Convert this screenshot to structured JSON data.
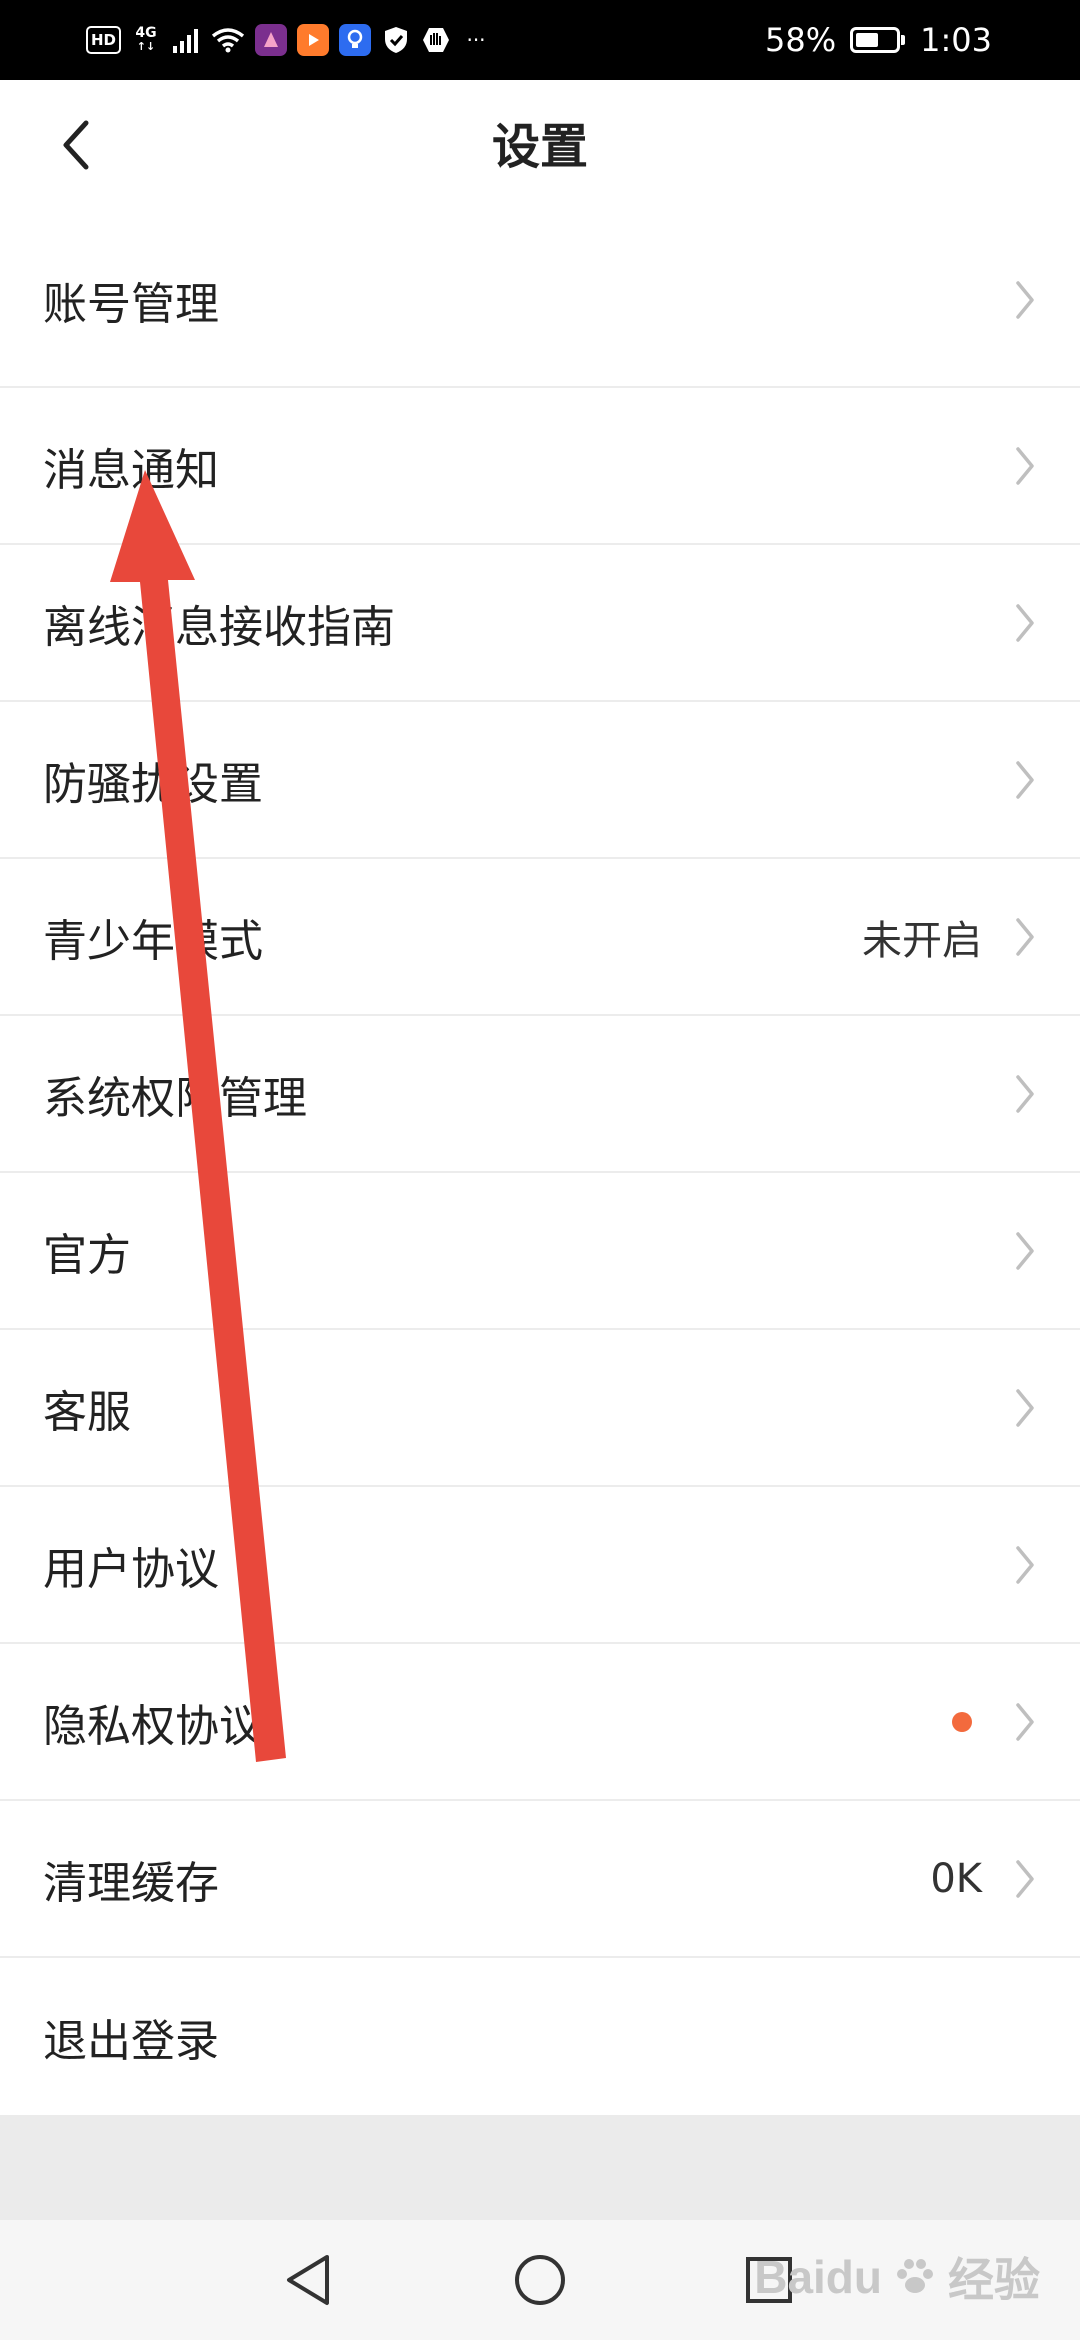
{
  "status_bar": {
    "hd_label": "HD",
    "network_label": "4G",
    "network_sublabel": "↑↓",
    "more_label": "···",
    "battery_text": "58%",
    "battery_level": 0.58,
    "time": "1:03",
    "icons": [
      "hd-icon",
      "signal-icon",
      "wifi-icon",
      "app-icon",
      "video-app-icon",
      "lightbulb-app-icon",
      "shield-icon",
      "hand-icon",
      "more-icon",
      "battery-icon"
    ]
  },
  "header": {
    "title": "设置",
    "back_icon": "chevron-left-icon"
  },
  "settings": {
    "items": [
      {
        "label": "账号管理",
        "value": ""
      },
      {
        "label": "消息通知",
        "value": ""
      },
      {
        "label": "离线消息接收指南",
        "value": ""
      },
      {
        "label": "防骚扰设置",
        "value": ""
      },
      {
        "label": "青少年模式",
        "value": "未开启"
      },
      {
        "label": "系统权限管理",
        "value": ""
      },
      {
        "label": "官方",
        "value": ""
      },
      {
        "label": "客服",
        "value": ""
      },
      {
        "label": "用户协议",
        "value": ""
      },
      {
        "label": "隐私权协议",
        "value": "",
        "has_dot": true
      },
      {
        "label": "清理缓存",
        "value": "0K"
      },
      {
        "label": "退出登录",
        "value": ""
      }
    ]
  },
  "nav_bar": {
    "icons": [
      "back-triangle-icon",
      "home-circle-icon",
      "recents-square-icon"
    ]
  },
  "watermark": {
    "brand": "Baidu",
    "text": "经验"
  },
  "colors": {
    "accent_dot": "#f36a3d",
    "arrow": "#e8483b",
    "chevron": "#bfbfbf"
  }
}
